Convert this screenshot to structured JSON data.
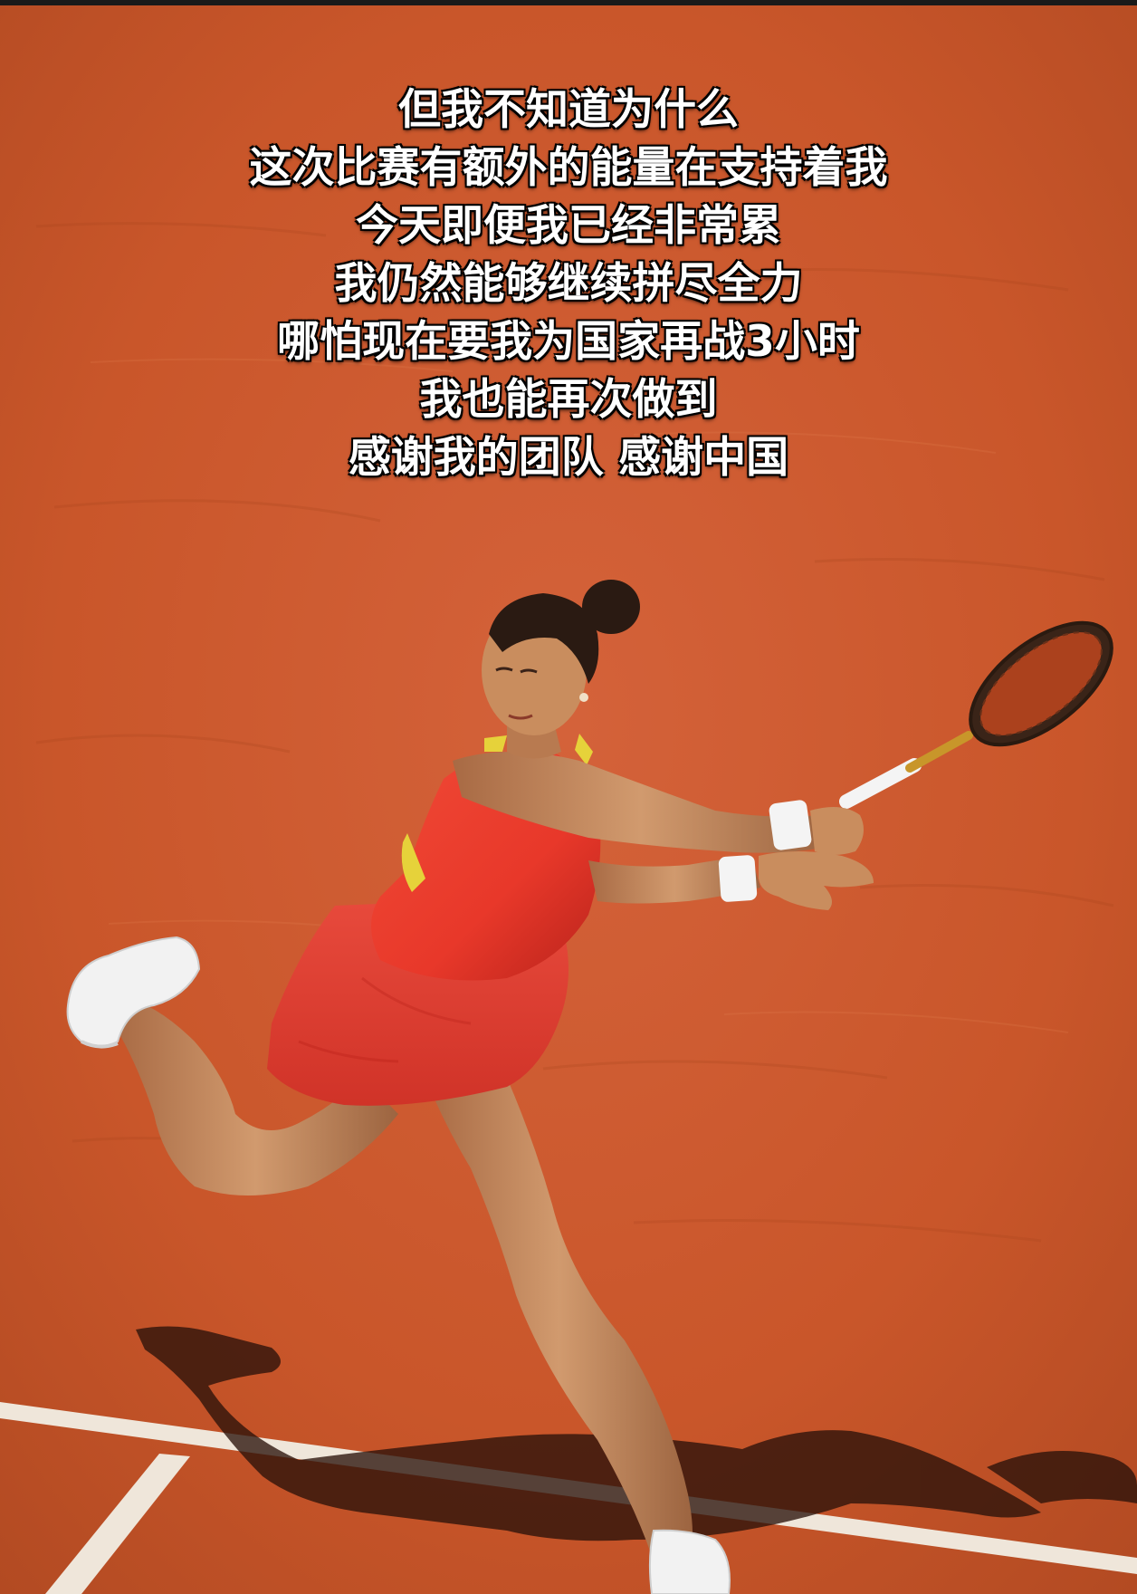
{
  "caption": {
    "lines": [
      "但我不知道为什么",
      "这次比赛有额外的能量在支持着我",
      "今天即便我已经非常累",
      "我仍然能够继续拼尽全力",
      "哪怕现在要我为国家再战3小时",
      "我也能再次做到",
      "感谢我的团队 感谢中国"
    ]
  },
  "colors": {
    "clay": "#c9562a",
    "clay_dark": "#b24a22",
    "clay_light": "#d8683a",
    "court_line": "#f4efe6",
    "dress": "#e8382a",
    "dress_shadow": "#b8231b",
    "accent_yellow": "#e6d23a",
    "skin": "#c98d5e",
    "skin_shadow": "#9c6440",
    "hair": "#2a1a12",
    "shoe": "#f2f2f2",
    "racket_head": "#3a2418",
    "racket_string": "#c0471e",
    "shadow": "#2a120a"
  },
  "icons": {
    "subject": "tennis-player-photo"
  }
}
